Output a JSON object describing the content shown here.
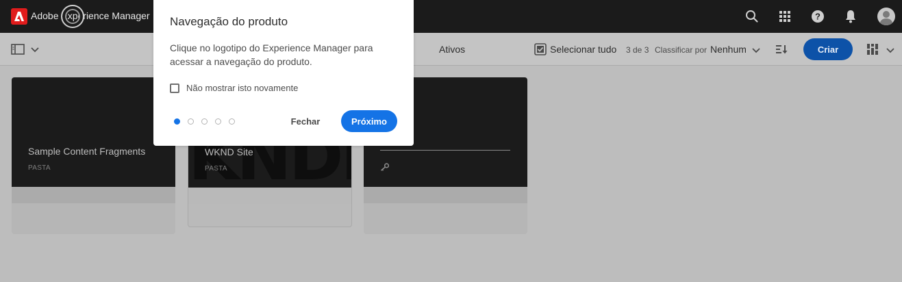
{
  "shell": {
    "brand": "Adobe Experience Manager",
    "icons": [
      "adobe-logo-icon",
      "search-icon",
      "apps-grid-icon",
      "help-icon",
      "notifications-bell-icon",
      "user-avatar-icon"
    ]
  },
  "actionbar": {
    "title": "Ativos",
    "select_all": "Selecionar tudo",
    "count": "3 de 3",
    "sort_label": "Classificar por",
    "sort_value": "Nenhum",
    "create_button": "Criar"
  },
  "cards": [
    {
      "title": "Sample Content Fragments",
      "type": "PASTA"
    },
    {
      "title": "WKND Site",
      "type": "PASTA",
      "thumb_text": "KNDKN"
    },
    {
      "title": "",
      "type": ""
    }
  ],
  "dialog": {
    "title": "Navegação do produto",
    "body": "Clique no logotipo do Experience Manager para acessar a navegação do produto.",
    "checkbox_label": "Não mostrar isto novamente",
    "close_button": "Fechar",
    "next_button": "Próximo",
    "steps_total": 5,
    "step_current": 1
  },
  "colors": {
    "shell_bg": "#1b1b1b",
    "accent_blue": "#1473e6",
    "overlay_page": "#bdbdbd",
    "adobe_red": "#e11c1c"
  }
}
